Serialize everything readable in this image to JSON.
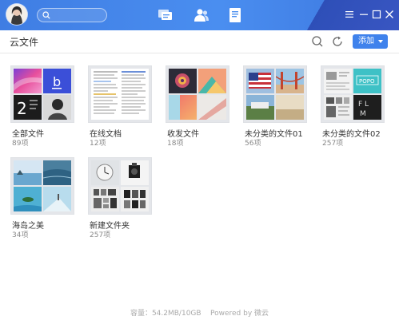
{
  "header": {
    "search_placeholder": "",
    "nav_icons": [
      "chat-icon",
      "contacts-icon",
      "document-icon"
    ],
    "window_controls": [
      "menu-icon",
      "minimize-icon",
      "maximize-icon",
      "close-icon"
    ],
    "accent": "#3f82ec"
  },
  "toolbar": {
    "title": "云文件",
    "add_label": "添加"
  },
  "folders": [
    {
      "name": "全部文件",
      "count": "89项"
    },
    {
      "name": "在线文档",
      "count": "12项"
    },
    {
      "name": "收发文件",
      "count": "18项"
    },
    {
      "name": "未分类的文件01",
      "count": "56项"
    },
    {
      "name": "未分类的文件02",
      "count": "257项"
    },
    {
      "name": "海岛之美",
      "count": "34项"
    },
    {
      "name": "新建文件夹",
      "count": "257项"
    }
  ],
  "footer": {
    "text": "容量：54.2MB/10GB    Powered by 微云"
  }
}
